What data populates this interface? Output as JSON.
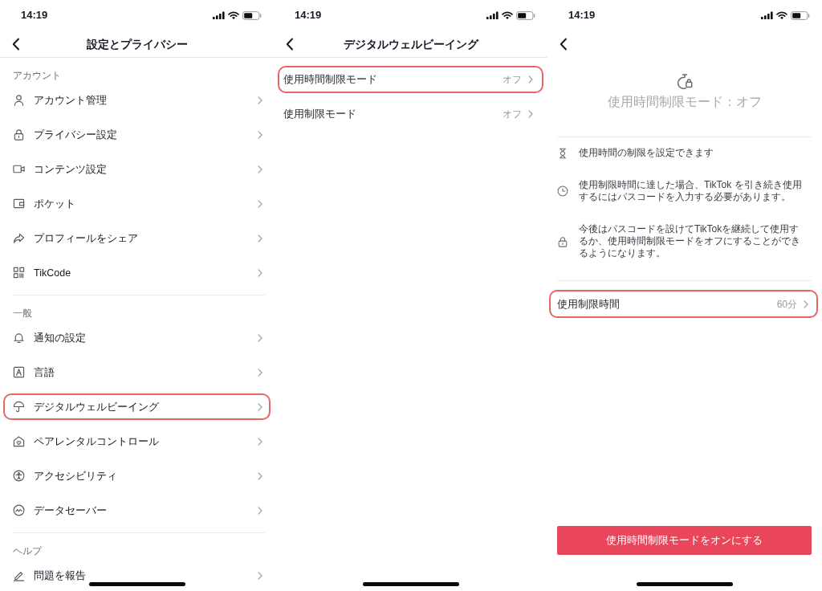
{
  "screens": [
    {
      "kind": "menu",
      "status_bar": {
        "time": "14:19"
      },
      "header": {
        "title": "設定とプライバシー"
      },
      "sections": [
        {
          "title": "アカウント",
          "items": [
            {
              "label": "アカウント管理",
              "highlighted": false
            },
            {
              "label": "プライバシー設定",
              "highlighted": false
            },
            {
              "label": "コンテンツ設定",
              "highlighted": false
            },
            {
              "label": "ポケット",
              "highlighted": false
            },
            {
              "label": "プロフィールをシェア",
              "highlighted": false
            },
            {
              "label": "TikCode",
              "highlighted": false
            }
          ]
        },
        {
          "title": "一般",
          "items": [
            {
              "label": "通知の設定",
              "highlighted": false
            },
            {
              "label": "言語",
              "highlighted": false
            },
            {
              "label": "デジタルウェルビーイング",
              "highlighted": true
            },
            {
              "label": "ペアレンタルコントロール",
              "highlighted": false
            },
            {
              "label": "アクセシビリティ",
              "highlighted": false
            },
            {
              "label": "データセーバー",
              "highlighted": false
            }
          ]
        },
        {
          "title": "ヘルプ",
          "items": [
            {
              "label": "問題を報告",
              "highlighted": false
            }
          ]
        }
      ]
    },
    {
      "kind": "list",
      "status_bar": {
        "time": "14:19"
      },
      "header": {
        "title": "デジタルウェルビーイング"
      },
      "items": [
        {
          "label": "使用時間制限モード",
          "value": "オフ",
          "highlighted": true
        },
        {
          "label": "使用制限モード",
          "value": "オフ",
          "highlighted": false
        }
      ]
    },
    {
      "kind": "detail",
      "status_bar": {
        "time": "14:19"
      },
      "mode_status": "使用時間制限モード：オフ",
      "info": [
        "使用時間の制限を設定できます",
        "使用制限時間に達した場合、TikTok を引き続き使用するにはパスコードを入力する必要があります。",
        "今後はパスコードを設けてTikTokを継続して使用するか、使用時間制限モードをオフにすることができるようになります。"
      ],
      "settings": [
        {
          "label": "使用制限時間",
          "value": "60分",
          "highlighted": true
        }
      ],
      "button": {
        "label": "使用時間制限モードをオンにする"
      }
    }
  ]
}
